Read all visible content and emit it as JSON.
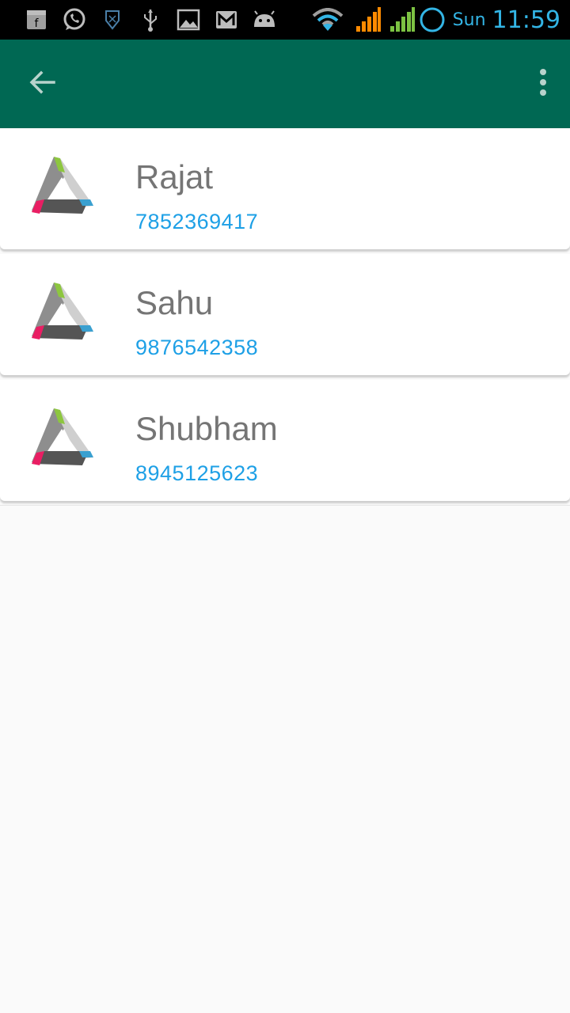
{
  "status_bar": {
    "notification_icons": [
      "shop-icon",
      "whatsapp-icon",
      "shield-icon",
      "usb-icon",
      "gallery-icon",
      "gmail-icon",
      "android-icon"
    ],
    "day": "Sun",
    "time": "11:59",
    "accent_color": "#33b5e5"
  },
  "app_bar": {
    "background_color": "#006853",
    "back_icon": "arrow-back-icon",
    "menu_icon": "more-vert-icon"
  },
  "contacts": [
    {
      "name": "Rajat",
      "phone": "7852369417"
    },
    {
      "name": "Sahu",
      "phone": "9876542358"
    },
    {
      "name": "Shubham",
      "phone": "8945125623"
    }
  ],
  "colors": {
    "name_text": "#757575",
    "phone_text": "#1ea0e6",
    "page_background": "#fafafa"
  }
}
